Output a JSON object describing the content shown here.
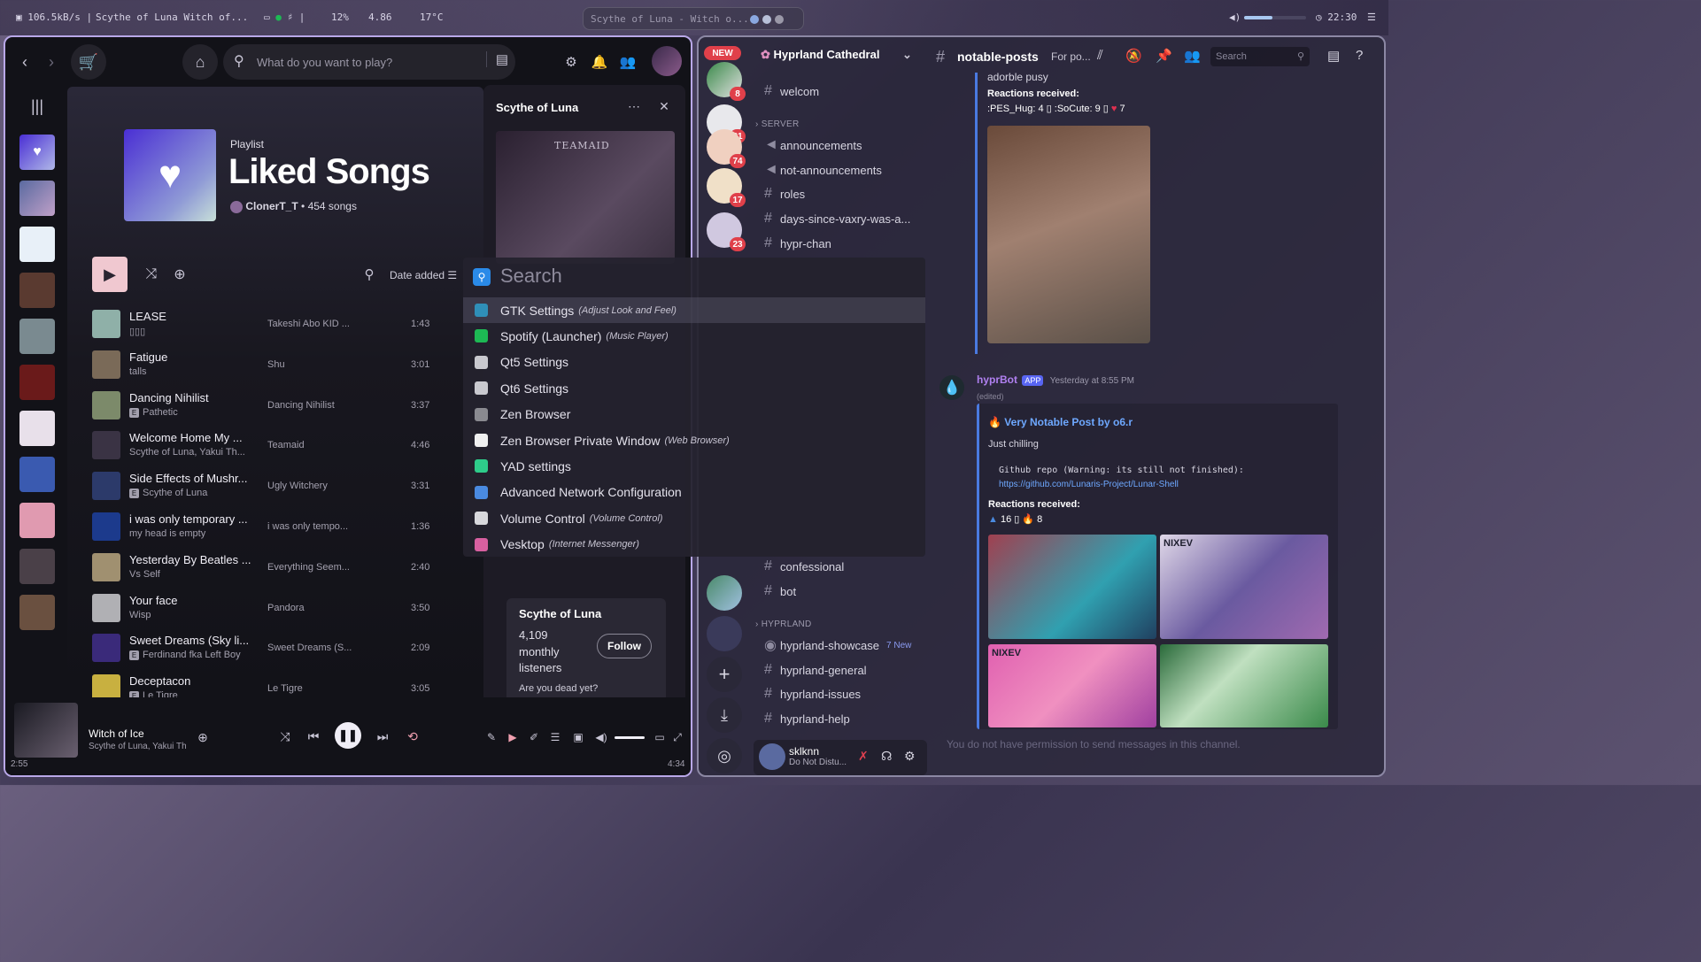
{
  "topbar": {
    "net_speed": "106.5kB/s",
    "sep": "|",
    "track_short": "Scythe of Luna  Witch of...",
    "stats": "12%",
    "mem": "4.86",
    "temp": "17°C",
    "center_title": "Scythe of Luna - Witch o...",
    "clock": "22:30"
  },
  "spotify": {
    "search_placeholder": "What do you want to play?",
    "playlist_label": "Playlist",
    "playlist_title": "Liked Songs",
    "owner": "ClonerT_T",
    "song_count": "• 454 songs",
    "sort_label": "Date added",
    "tracks": [
      {
        "name": "LEASE",
        "artist": "▯▯▯",
        "album": "Takeshi Abo KID ...",
        "duration": "1:43",
        "color": "#8fb0a8",
        "explicit": false
      },
      {
        "name": "Fatigue",
        "artist": "talls",
        "album": "Shu",
        "duration": "3:01",
        "color": "#7a6a58",
        "explicit": false
      },
      {
        "name": "Dancing Nihilist",
        "artist": "Pathetic",
        "album": "Dancing Nihilist",
        "duration": "3:37",
        "color": "#7c8a6a",
        "explicit": true
      },
      {
        "name": "Welcome Home My ...",
        "artist": "Scythe of Luna, Yakui Th...",
        "album": "Teamaid",
        "duration": "4:46",
        "color": "#3a3344",
        "explicit": false
      },
      {
        "name": "Side Effects of Mushr...",
        "artist": "Scythe of Luna",
        "album": "Ugly Witchery",
        "duration": "3:31",
        "color": "#2c3a6a",
        "explicit": true
      },
      {
        "name": "i was only temporary ...",
        "artist": "my head is empty",
        "album": "i was only tempo...",
        "duration": "1:36",
        "color": "#1c3a8c",
        "explicit": false
      },
      {
        "name": "Yesterday By Beatles ...",
        "artist": "Vs Self",
        "album": "Everything Seem...",
        "duration": "2:40",
        "color": "#a09070",
        "explicit": false
      },
      {
        "name": "Your face",
        "artist": "Wisp",
        "album": "Pandora",
        "duration": "3:50",
        "color": "#b0b0b4",
        "explicit": false
      },
      {
        "name": "Sweet Dreams (Sky li...",
        "artist": "Ferdinand fka Left Boy",
        "album": "Sweet Dreams (S...",
        "duration": "2:09",
        "color": "#3a2a7a",
        "explicit": true
      },
      {
        "name": "Deceptacon",
        "artist": "Le Tigre",
        "album": "Le Tigre",
        "duration": "3:05",
        "color": "#c8b040",
        "explicit": true
      }
    ],
    "np_panel": {
      "title": "Scythe of Luna",
      "cover_text": "TEAMAID",
      "artist": "Scythe of Luna",
      "listeners_num": "4,109",
      "listeners_label": "monthly listeners",
      "follow": "Follow",
      "bio": "Are you dead yet?"
    },
    "player": {
      "title": "Witch of Ice",
      "artist": "Scythe of Luna, Yakui Th",
      "elapsed": "2:55",
      "total": "4:34"
    }
  },
  "launcher": {
    "placeholder": "Search",
    "items": [
      {
        "name": "GTK Settings",
        "sub": "(Adjust Look and Feel)",
        "color": "#2f8fb8"
      },
      {
        "name": "Spotify (Launcher)",
        "sub": "(Music Player)",
        "color": "#1db954"
      },
      {
        "name": "Qt5 Settings",
        "sub": "",
        "color": "#c9c9cf"
      },
      {
        "name": "Qt6 Settings",
        "sub": "",
        "color": "#c9c9cf"
      },
      {
        "name": "Zen Browser",
        "sub": "",
        "color": "#8a8a90"
      },
      {
        "name": "Zen Browser Private Window",
        "sub": "(Web Browser)",
        "color": "#f0f0f0"
      },
      {
        "name": "YAD settings",
        "sub": "",
        "color": "#2ecc8a"
      },
      {
        "name": "Advanced Network Configuration",
        "sub": "",
        "color": "#4a8ae0"
      },
      {
        "name": "Volume Control",
        "sub": "(Volume Control)",
        "color": "#d8d8dc"
      },
      {
        "name": "Vesktop",
        "sub": "(Internet Messenger)",
        "color": "#d860a0"
      }
    ]
  },
  "discord": {
    "server_name": "Hyprland Cathedral",
    "channel_name": "notable-posts",
    "channel_topic": "For po...",
    "search_placeholder": "Search",
    "new_label": "NEW",
    "server_badges": [
      "8",
      "31",
      "74",
      "17",
      "23"
    ],
    "channels_top": [
      "welcom"
    ],
    "category_server": "SERVER",
    "server_channels": [
      "announcements",
      "not-announcements",
      "roles",
      "days-since-vaxry-was-a...",
      "hypr-chan"
    ],
    "channels_bottom": [
      "confessional",
      "bot"
    ],
    "category_hyprland": "HYPRLAND",
    "hyprland_channels": [
      "hyprland-showcase",
      "hyprland-general",
      "hyprland-issues",
      "hyprland-help"
    ],
    "showcase_new": "7 New",
    "user_name": "sklknn",
    "user_status": "Do Not Distu...",
    "msg1": {
      "text": "adorble pusy",
      "reactions_label": "Reactions received:",
      "reactions": ":PES_Hug: 4 ▯ :SoCute: 9 ▯",
      "heart_count": "7"
    },
    "msg2": {
      "author": "hyprBot",
      "app_tag": "APP",
      "time": "Yesterday at 8:55 PM",
      "edited": "(edited)",
      "embed_title": "Very Notable Post by o6.r",
      "body": "Just chilling",
      "repo_line": "Github repo (Warning: its still not finished):",
      "link": "https://github.com/Lunaris-Project/Lunar-Shell",
      "reactions_label": "Reactions received:",
      "reactions": "16 ▯",
      "fire_count": "8",
      "thumb_labels": [
        "NIXEV",
        "NIXEV"
      ]
    },
    "no_permission": "You do not have permission to send messages in this channel."
  }
}
